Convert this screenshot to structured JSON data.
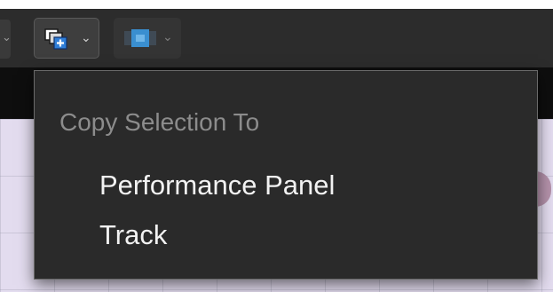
{
  "toolbar": {
    "copy_button": {
      "icon": "copy-to-icon",
      "accent": "#2f7ed8"
    },
    "blocks_button": {
      "icon": "blocks-icon",
      "accent": "#3a8fd0"
    }
  },
  "menu": {
    "header": "Copy Selection To",
    "items": [
      {
        "label": "Performance Panel"
      },
      {
        "label": "Track"
      }
    ]
  },
  "colors": {
    "toolbar_bg": "#2c2c2c",
    "menu_bg": "#2a2a2a",
    "menu_border": "#6a6a6a",
    "header_text": "#8c8c8c",
    "item_text": "#f2f2f2",
    "grid_bg": "#e3dcef"
  }
}
